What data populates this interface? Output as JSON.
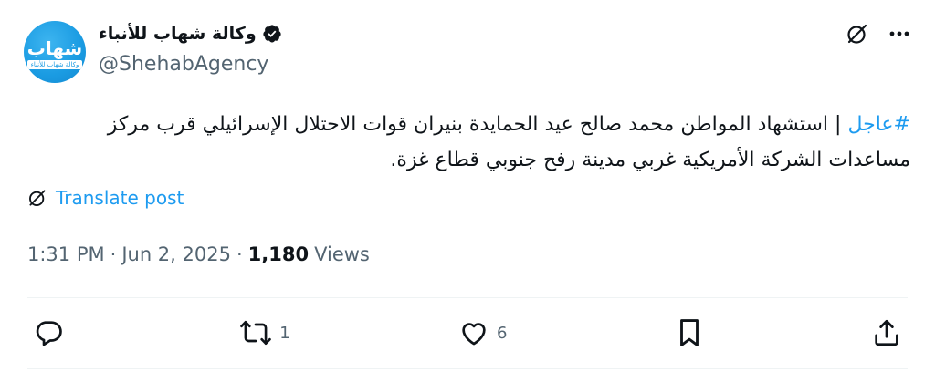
{
  "account": {
    "display_name": "وكالة شهاب للأنباء",
    "handle": "@ShehabAgency",
    "avatar_logo": "شهاب",
    "avatar_tagline": "وكالة شهاب للأنباء",
    "verified_badge": "verified-badge-icon"
  },
  "tweet": {
    "hashtag": "#عاجل",
    "separator": "|",
    "body_line1": "استشهاد المواطن محمد صالح عيد الحمايدة بنيران قوات الاحتلال الإسرائيلي قرب مركز",
    "body_line2": "مساعدات الشركة الأمريكية غربي مدينة رفح جنوبي قطاع غزة.",
    "translate_label": "Translate post"
  },
  "meta": {
    "time": "1:31 PM",
    "dot1": "·",
    "date": "Jun 2, 2025",
    "dot2": "·",
    "views_count": "1,180",
    "views_label": "Views"
  },
  "actions": {
    "reply_count": "",
    "repost_count": "1",
    "like_count": "6"
  },
  "colors": {
    "accent": "#1d9bf0",
    "secondary_text": "#536471",
    "primary_text": "#0f1419",
    "divider": "#eff3f4"
  }
}
